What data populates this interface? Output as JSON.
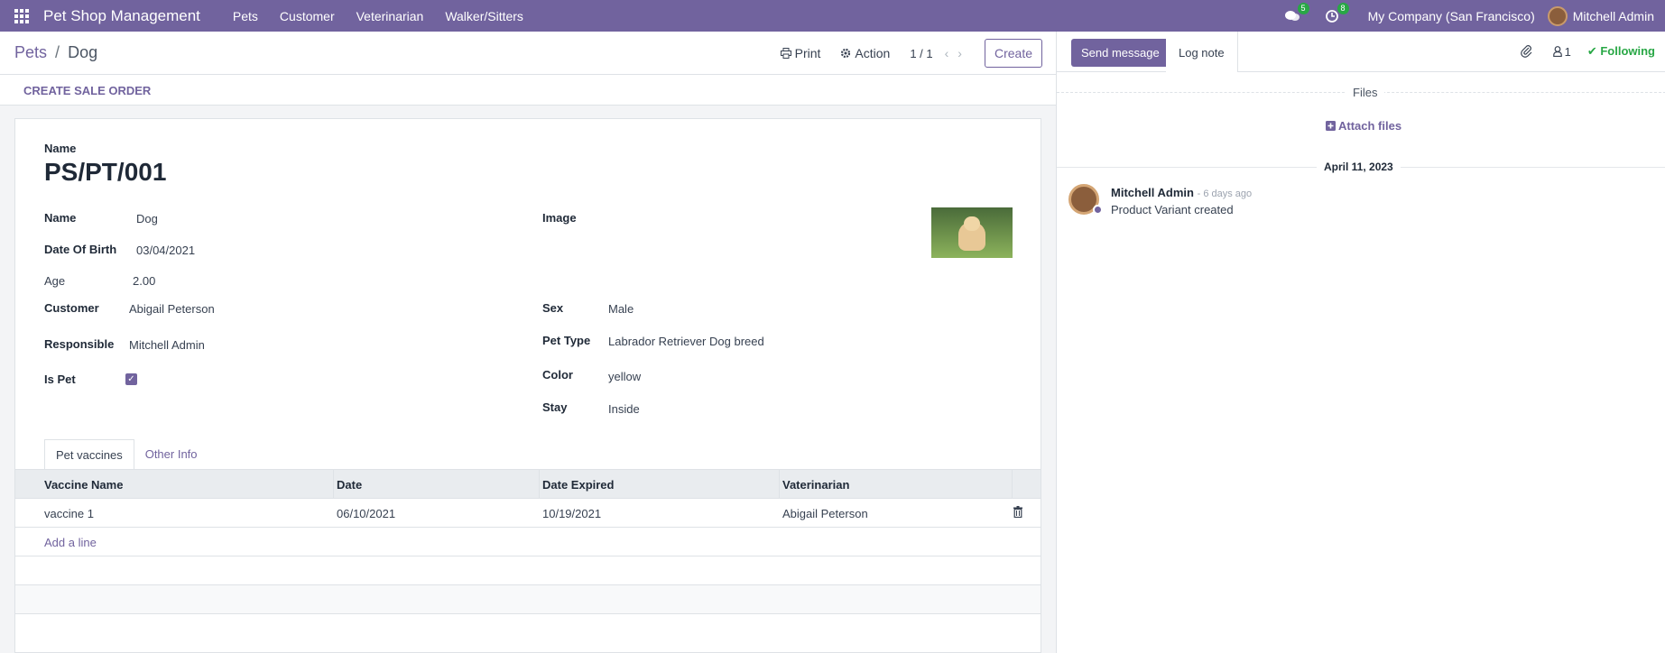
{
  "app": {
    "brand": "Pet Shop Management"
  },
  "topmenu": [
    "Pets",
    "Customer",
    "Veterinarian",
    "Walker/Sitters"
  ],
  "systray": {
    "messages_count": "5",
    "activities_count": "8",
    "company": "My Company (San Francisco)",
    "user": "Mitchell Admin"
  },
  "control": {
    "breadcrumb_parent": "Pets",
    "breadcrumb_sep": "/",
    "breadcrumb_current": "Dog",
    "print": "Print",
    "action": "Action",
    "pager": "1 / 1",
    "create": "Create"
  },
  "statusbar": {
    "create_sale_order": "CREATE SALE ORDER"
  },
  "form": {
    "title_label": "Name",
    "title": "PS/PT/001",
    "fields": {
      "name_label": "Name",
      "name": "Dog",
      "dob_label": "Date Of Birth",
      "dob": "03/04/2021",
      "age_label": "Age",
      "age": "2.00",
      "customer_label": "Customer",
      "customer": "Abigail Peterson",
      "responsible_label": "Responsible",
      "responsible": "Mitchell Admin",
      "is_pet_label": "Is Pet",
      "is_pet": true,
      "image_label": "Image",
      "sex_label": "Sex",
      "sex": "Male",
      "pet_type_label": "Pet Type",
      "pet_type": "Labrador Retriever Dog breed",
      "color_label": "Color",
      "color": "yellow",
      "stay_label": "Stay",
      "stay": "Inside"
    },
    "tabs": [
      "Pet vaccines",
      "Other Info"
    ],
    "vaccines": {
      "columns": [
        "Vaccine Name",
        "Date",
        "Date Expired",
        "Vaterinarian"
      ],
      "rows": [
        [
          "vaccine 1",
          "06/10/2021",
          "10/19/2021",
          "Abigail Peterson"
        ]
      ],
      "add_line": "Add a line"
    }
  },
  "chatter": {
    "send_message": "Send message",
    "log_note": "Log note",
    "followers_count": "1",
    "following": "Following",
    "files_label": "Files",
    "attach_files": "Attach files",
    "date": "April 11, 2023",
    "message": {
      "author": "Mitchell Admin",
      "time": "- 6 days ago",
      "body": "Product Variant created"
    }
  },
  "colors": {
    "brand": "#71639e",
    "success": "#28a745"
  }
}
